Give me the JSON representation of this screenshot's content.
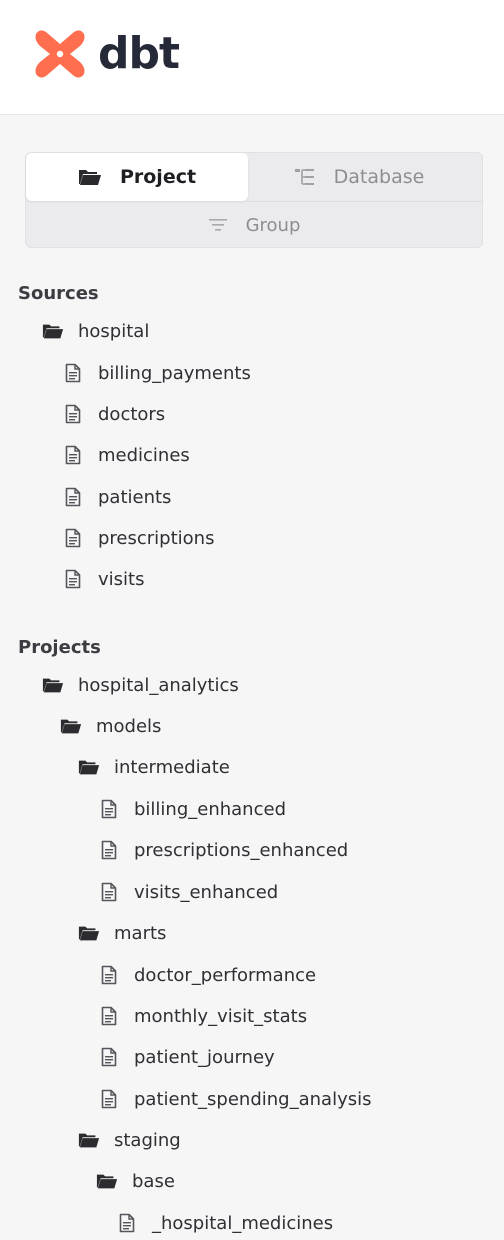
{
  "brand": {
    "name": "dbt",
    "accent": "#fe6e4f",
    "text_color": "#262a38"
  },
  "tabs": [
    {
      "label": "Project",
      "icon": "folder-open-icon",
      "active": true
    },
    {
      "label": "Database",
      "icon": "database-tree-icon",
      "active": false
    }
  ],
  "group": {
    "label": "Group",
    "icon": "filter-lines-icon"
  },
  "sources": {
    "title": "Sources",
    "folder": "hospital",
    "files": [
      "billing_payments",
      "doctors",
      "medicines",
      "patients",
      "prescriptions",
      "visits"
    ]
  },
  "projects": {
    "title": "Projects",
    "root": "hospital_analytics",
    "models_folder": "models",
    "intermediate": {
      "folder": "intermediate",
      "files": [
        "billing_enhanced",
        "prescriptions_enhanced",
        "visits_enhanced"
      ]
    },
    "marts": {
      "folder": "marts",
      "files": [
        "doctor_performance",
        "monthly_visit_stats",
        "patient_journey",
        "patient_spending_analysis"
      ]
    },
    "staging": {
      "folder": "staging",
      "base_folder": "base",
      "base_files": [
        "_hospital_medicines"
      ]
    }
  }
}
